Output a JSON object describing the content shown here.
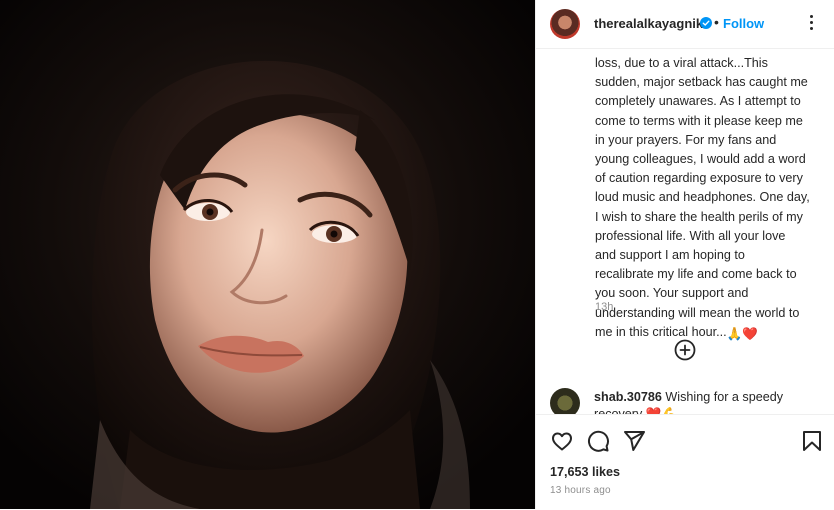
{
  "post": {
    "username": "therealalkayagnik",
    "follow_label": "Follow",
    "separator": "•",
    "caption_lines": [
      "loss, due to a viral attack...This",
      "sudden, major setback has caught me",
      "completely unawares. As I attempt to",
      "come to terms with it please keep me",
      "in your prayers. For my fans and",
      "young colleagues, I would add a word",
      "of caution regarding exposure to very",
      "loud music and headphones. One day,",
      "I wish to share the health perils of my",
      "professional life. With all your love",
      "and support I am hoping to",
      "recalibrate my life and come back to",
      "you soon. Your support and",
      "understanding will mean the world to",
      "me in this critical hour..."
    ],
    "caption_emojis": "🙏❤️",
    "caption_time": "13h",
    "likes": "17,653 likes",
    "time_ago": "13 hours ago"
  },
  "comment": {
    "username": "shab.30786",
    "text": "Wishing for a speedy recovery",
    "emojis": "❤️💪"
  },
  "icons": {
    "verified": "verified-badge-icon",
    "more": "more-options-icon",
    "add": "add-circle-icon",
    "like": "heart-icon",
    "comment": "comment-icon",
    "share": "share-icon",
    "save": "bookmark-icon"
  },
  "colors": {
    "accent": "#0095f6",
    "text": "#262626",
    "muted": "#8e8e8e",
    "border": "#efefef"
  }
}
